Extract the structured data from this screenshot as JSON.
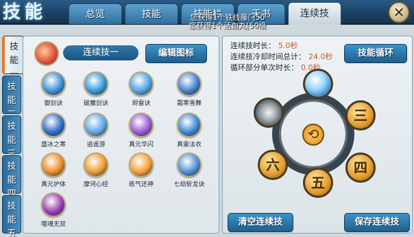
{
  "window": {
    "title": "技能",
    "close": "✕"
  },
  "tabs": [
    {
      "label": "总览"
    },
    {
      "label": "技能"
    },
    {
      "label": "技能栏"
    },
    {
      "label": "天书"
    },
    {
      "label": "连续技",
      "active": true
    }
  ],
  "notices": [
    "您获得1个铁线藤门50",
    "您获得1个活血丸[50级"
  ],
  "side_tabs": [
    {
      "label": "技\n能\n一",
      "active": true
    },
    {
      "label": "技\n能\n二"
    },
    {
      "label": "技\n能\n三"
    },
    {
      "label": "技\n能\n四"
    },
    {
      "label": "技\n能\n五"
    }
  ],
  "combo": {
    "label": "连续技一",
    "edit_icon_button": "编辑图标"
  },
  "skills": [
    {
      "name": "御剑诀",
      "color": "#3a8fd9"
    },
    {
      "name": "破魔剑诀",
      "color": "#2f9be0"
    },
    {
      "name": "烬雷诀",
      "color": "#4aa3e8"
    },
    {
      "name": "霜寒雪舞",
      "color": "#3f7fd0"
    },
    {
      "name": "盛冰之寒",
      "color": "#2e6ccc"
    },
    {
      "name": "逍遥游",
      "color": "#5aa6e6"
    },
    {
      "name": "真元华闪",
      "color": "#9a58d8"
    },
    {
      "name": "真雷法衣",
      "color": "#3b86d6"
    },
    {
      "name": "真元护体",
      "color": "#f08a24"
    },
    {
      "name": "摩诃心经",
      "color": "#f39a2b"
    },
    {
      "name": "练气还神",
      "color": "#f7a032"
    },
    {
      "name": "七劫斩龙诀",
      "color": "#4c8fd8"
    },
    {
      "name": "噬魂无双",
      "color": "#9a3db2"
    }
  ],
  "stats": [
    {
      "label": "连续技时长：",
      "value": "5.0秒"
    },
    {
      "label": "连续技冷却时间总计：",
      "value": "24.0秒"
    },
    {
      "label": "循环部分单次时长：",
      "value": "0.0秒"
    }
  ],
  "skill_loop_button": "技能循环",
  "wheel": {
    "slots": [
      "",
      "",
      "三",
      "四",
      "五",
      "六"
    ],
    "loop_icon": "⟲"
  },
  "bottom_buttons": {
    "clear": "清空连续技",
    "save": "保存连续技"
  }
}
